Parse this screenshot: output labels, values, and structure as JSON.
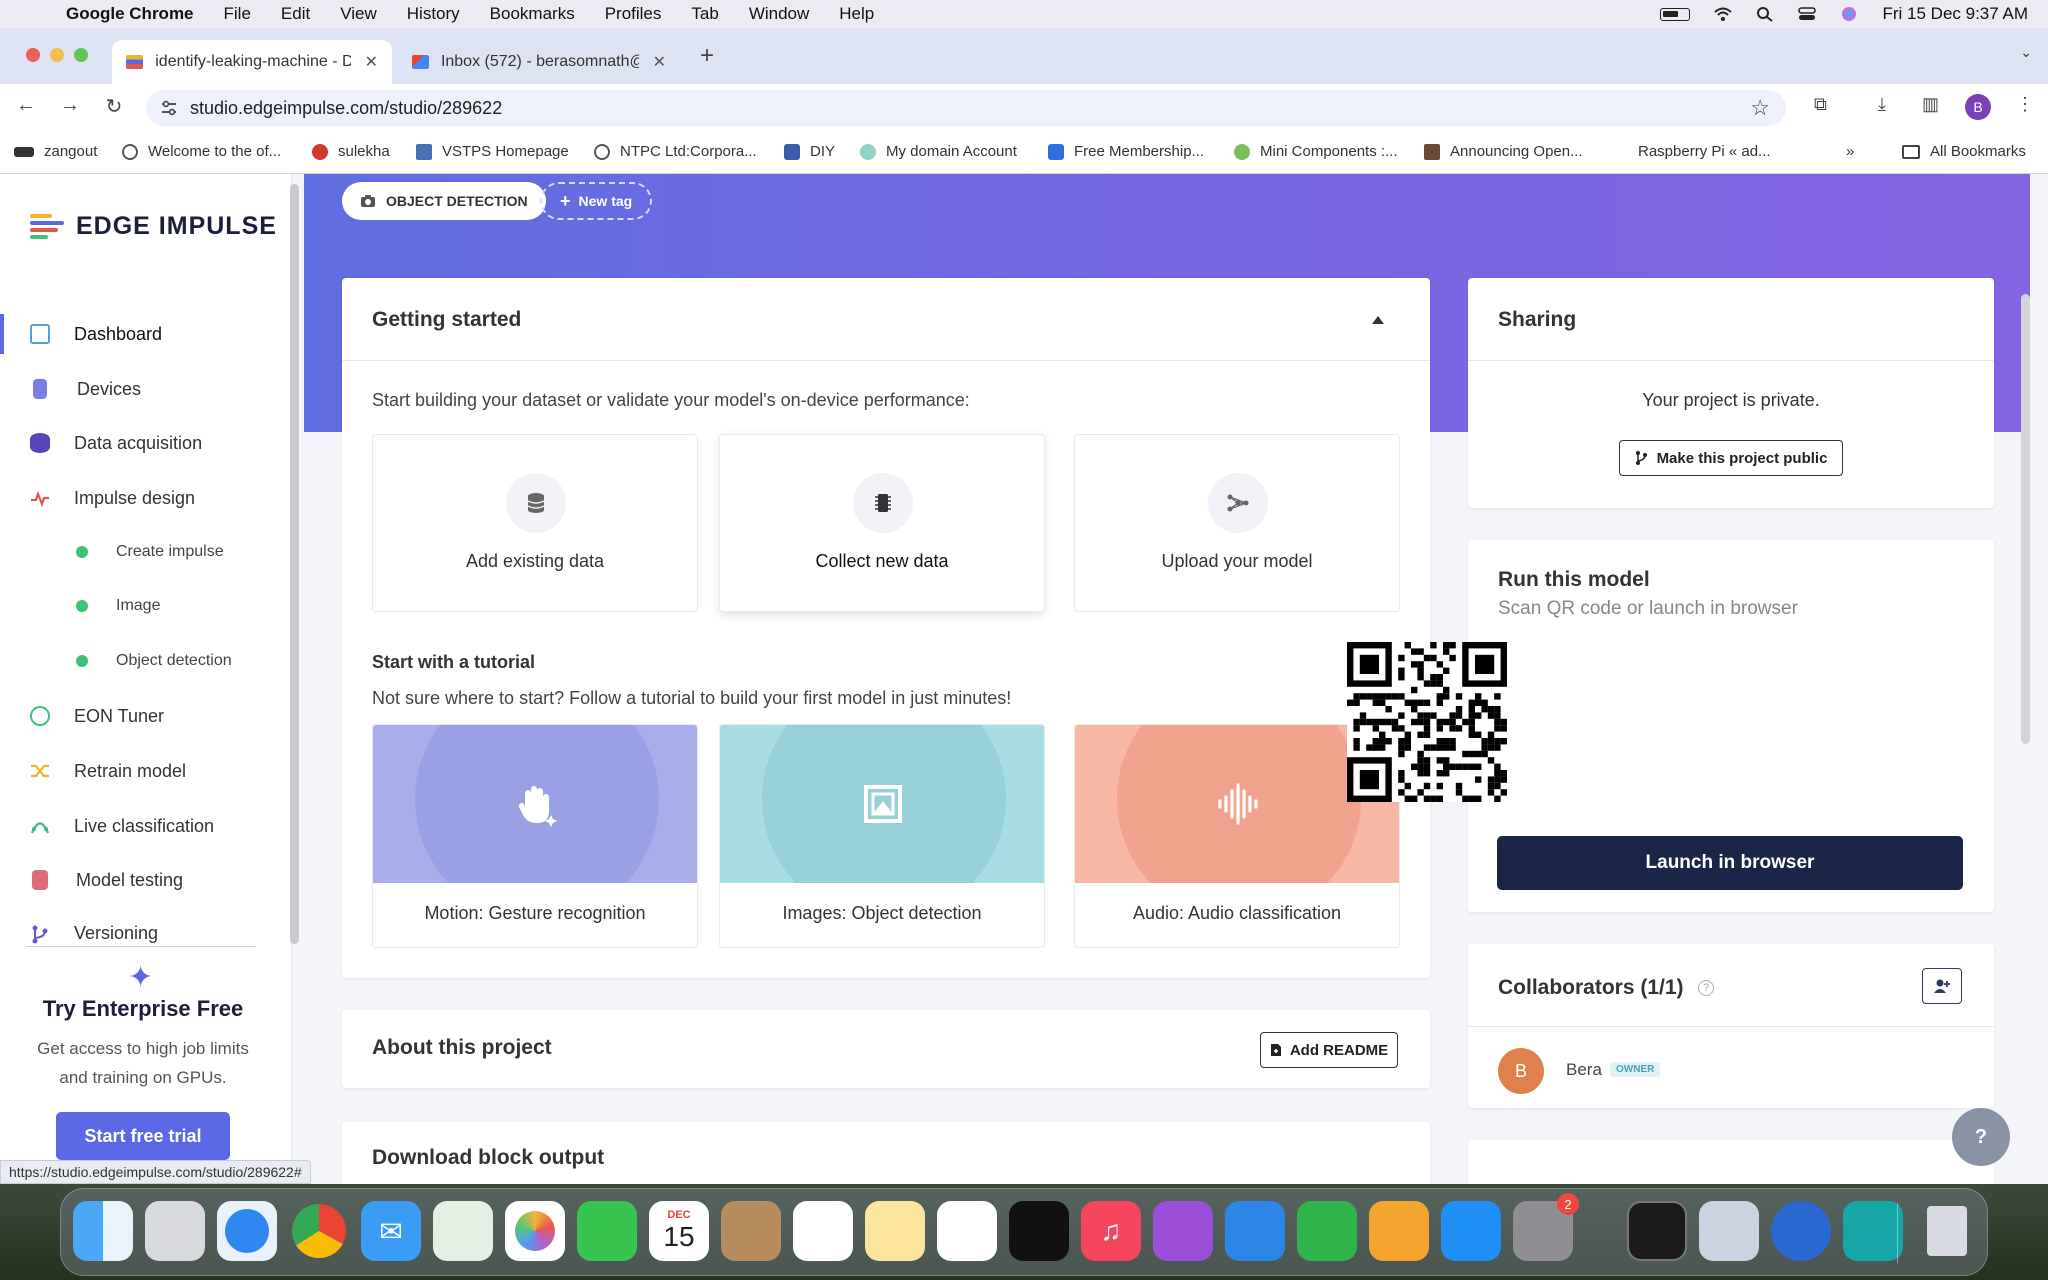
{
  "menubar": {
    "app_name": "Google Chrome",
    "items": [
      "File",
      "Edit",
      "View",
      "History",
      "Bookmarks",
      "Profiles",
      "Tab",
      "Window",
      "Help"
    ],
    "datetime": "Fri 15 Dec  9:37 AM"
  },
  "browser": {
    "tabs": [
      {
        "title": "identify-leaking-machine - Da",
        "favicon": "edge-impulse-icon"
      },
      {
        "title": "Inbox (572) - berasomnath@g",
        "favicon": "gmail-icon"
      }
    ],
    "url": "studio.edgeimpulse.com/studio/289622",
    "profile_initial": "B",
    "bookmarks": [
      "zangout",
      "Welcome to the of...",
      "sulekha",
      "VSTPS Homepage",
      "NTPC Ltd:Corpora...",
      "DIY",
      "My domain Account",
      "Free Membership...",
      "Mini Components :...",
      "Announcing Open...",
      "Raspberry Pi « ad..."
    ],
    "bookmarks_overflow": "»",
    "all_bookmarks": "All Bookmarks",
    "status_url": "https://studio.edgeimpulse.com/studio/289622#"
  },
  "sidebar": {
    "logo": "EDGE IMPULSE",
    "items": [
      {
        "label": "Dashboard",
        "icon": "monitor-icon",
        "color": "#5b9bd5"
      },
      {
        "label": "Devices",
        "icon": "chip-icon",
        "color": "#7b7fe6"
      },
      {
        "label": "Data acquisition",
        "icon": "database-icon",
        "color": "#5a45b8"
      },
      {
        "label": "Impulse design",
        "icon": "pulse-icon",
        "color": "#e0574c"
      },
      {
        "label": "EON Tuner",
        "icon": "compass-icon",
        "color": "#3cc27a"
      },
      {
        "label": "Retrain model",
        "icon": "shuffle-icon",
        "color": "#f0b429"
      },
      {
        "label": "Live classification",
        "icon": "graph-icon",
        "color": "#3cb58a"
      },
      {
        "label": "Model testing",
        "icon": "clipboard-icon",
        "color": "#e06d7a"
      },
      {
        "label": "Versioning",
        "icon": "branch-icon",
        "color": "#6a5acd"
      }
    ],
    "sub_items": [
      "Create impulse",
      "Image",
      "Object detection"
    ],
    "enterprise": {
      "title": "Try Enterprise Free",
      "desc_line1": "Get access to high job limits",
      "desc_line2": "and training on GPUs.",
      "button": "Start free trial"
    }
  },
  "tags": {
    "project_tag": "OBJECT DETECTION",
    "new_tag": "New tag"
  },
  "getting_started": {
    "title": "Getting started",
    "intro": "Start building your dataset or validate your model's on-device performance:",
    "options": [
      {
        "label": "Add existing data",
        "icon": "database-icon"
      },
      {
        "label": "Collect new data",
        "icon": "chip-icon"
      },
      {
        "label": "Upload your model",
        "icon": "network-icon"
      }
    ],
    "tutorial_title": "Start with a tutorial",
    "tutorial_desc": "Not sure where to start? Follow a tutorial to build your first model in just minutes!",
    "tutorials": [
      {
        "label": "Motion: Gesture recognition",
        "icon": "hand-icon",
        "bg": "#a9aeea",
        "circle": "#9aa0e4"
      },
      {
        "label": "Images: Object detection",
        "icon": "image-frame-icon",
        "bg": "#a8dce3",
        "circle": "#96d1da"
      },
      {
        "label": "Audio: Audio classification",
        "icon": "waveform-icon",
        "bg": "#f6b7a3",
        "circle": "#f2a38d"
      }
    ]
  },
  "about": {
    "title": "About this project",
    "button": "Add README"
  },
  "download": {
    "title": "Download block output"
  },
  "sharing": {
    "title": "Sharing",
    "status": "Your project is private.",
    "button": "Make this project public"
  },
  "run_model": {
    "title": "Run this model",
    "subtitle": "Scan QR code or launch in browser",
    "button": "Launch in browser"
  },
  "collaborators": {
    "title": "Collaborators (1/1)",
    "members": [
      {
        "initial": "B",
        "name": "Bera",
        "role": "OWNER"
      }
    ]
  },
  "dock": {
    "calendar_month": "DEC",
    "calendar_day": "15",
    "settings_badge": "2"
  },
  "colors": {
    "accent": "#5b68e6",
    "banner_start": "#5f6ee0",
    "banner_end": "#8464e3",
    "launch_button": "#1b2547"
  }
}
